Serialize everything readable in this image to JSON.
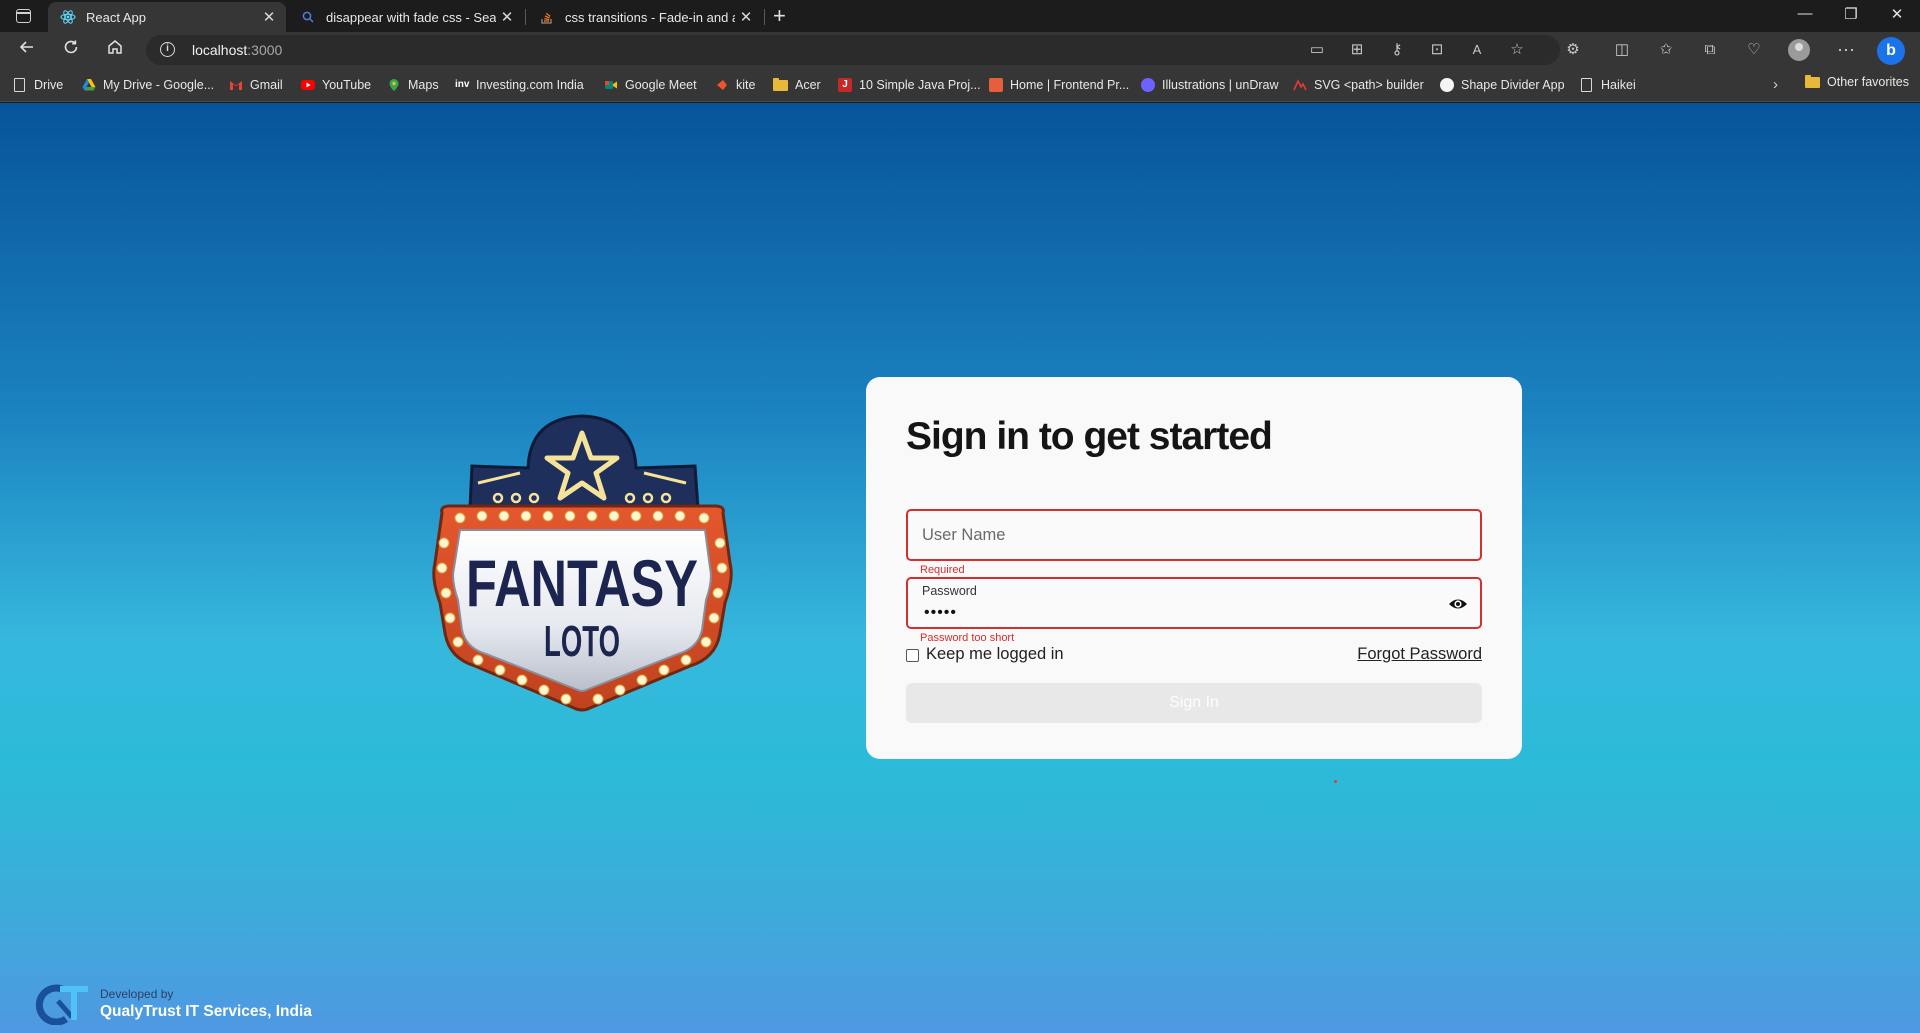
{
  "browser": {
    "tabs": [
      {
        "label": "React App",
        "active": true
      },
      {
        "label": "disappear with fade css - Search",
        "active": false
      },
      {
        "label": "css transitions - Fade-in and app",
        "active": false
      }
    ],
    "address": {
      "host": "localhost",
      "port": ":3000"
    },
    "bookmarks": [
      {
        "label": "Drive",
        "icon": "page-icon"
      },
      {
        "label": "My Drive - Google...",
        "icon": "google-drive-icon"
      },
      {
        "label": "Gmail",
        "icon": "gmail-icon"
      },
      {
        "label": "YouTube",
        "icon": "youtube-icon"
      },
      {
        "label": "Maps",
        "icon": "maps-icon"
      },
      {
        "label": "Investing.com India",
        "icon": "investing-icon"
      },
      {
        "label": "Google Meet",
        "icon": "meet-icon"
      },
      {
        "label": "kite",
        "icon": "kite-icon"
      },
      {
        "label": "Acer",
        "icon": "folder-icon"
      },
      {
        "label": "10 Simple Java Proj...",
        "icon": "java-icon"
      },
      {
        "label": "Home | Frontend Pr...",
        "icon": "frontend-icon"
      },
      {
        "label": "Illustrations | unDraw",
        "icon": "undraw-icon"
      },
      {
        "label": "SVG <path> builder",
        "icon": "svg-builder-icon"
      },
      {
        "label": "Shape Divider App",
        "icon": "shape-divider-icon"
      },
      {
        "label": "Haikei",
        "icon": "page-icon"
      }
    ],
    "other_favorites": "Other favorites"
  },
  "logo": {
    "line1": "FANTASY",
    "line2": "LOTO"
  },
  "signin": {
    "title": "Sign in to get started",
    "username_placeholder": "User Name",
    "username_error": "Required",
    "password_label": "Password",
    "password_masked": "•••••",
    "password_error": "Password too short",
    "keep_logged_in": "Keep me logged in",
    "forgot_password": "Forgot Password",
    "submit": "Sign In"
  },
  "footer": {
    "developed_by": "Developed by",
    "company": "QualyTrust IT Services, India"
  },
  "colors": {
    "error": "#d32f2f",
    "card": "#f9f9f9",
    "button_disabled": "#e8e8e8"
  }
}
